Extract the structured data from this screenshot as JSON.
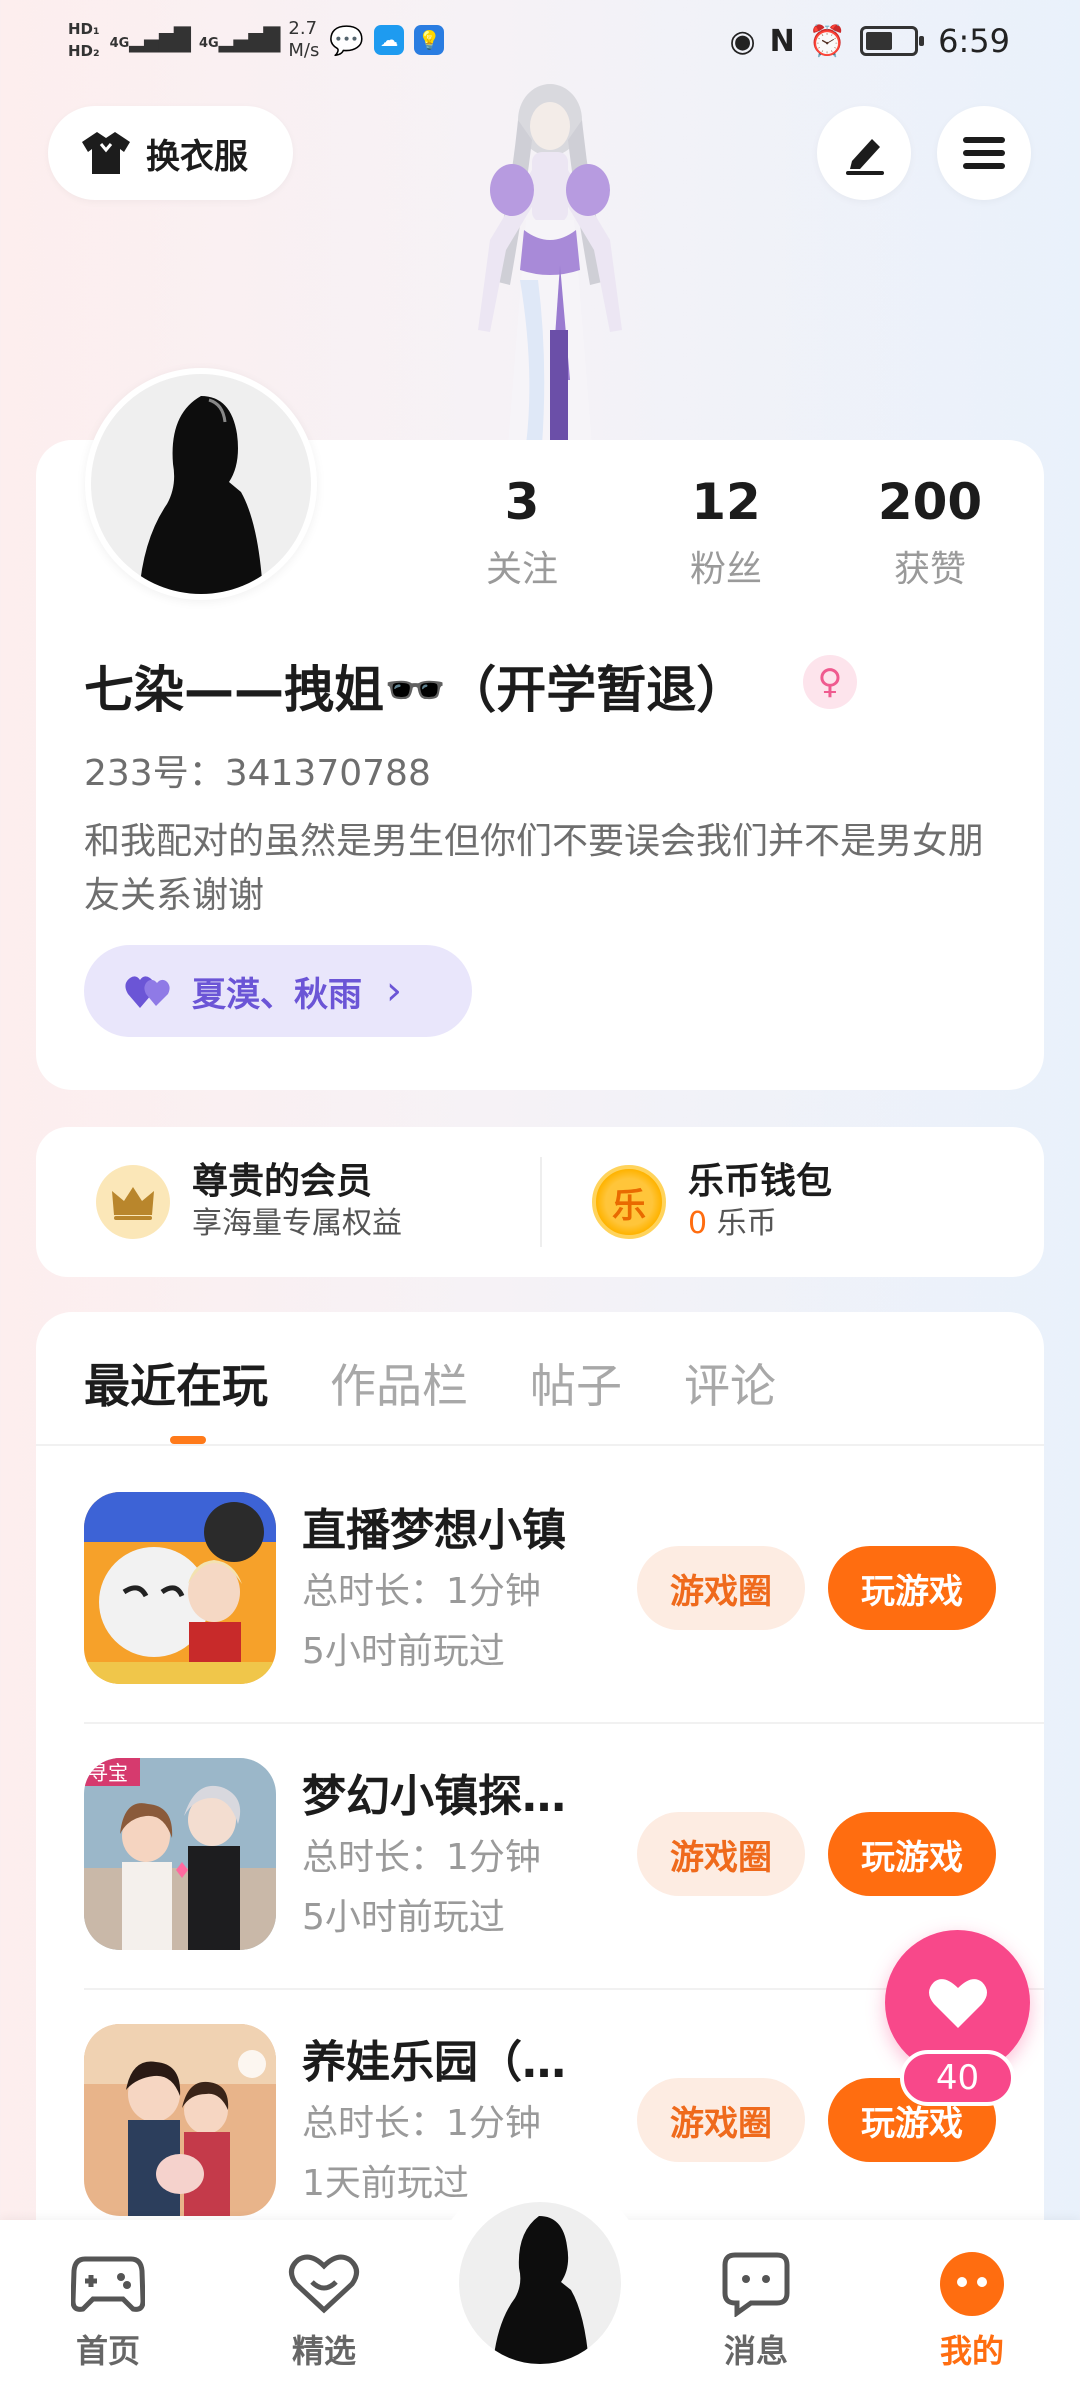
{
  "status_bar": {
    "hd1": "HD₁",
    "hd2": "HD₂",
    "signal1": "4G",
    "signal2": "4G",
    "speed_value": "2.7",
    "speed_unit": "M/s",
    "time": "6:59"
  },
  "header": {
    "outfit_label": "换衣服"
  },
  "profile": {
    "stats": [
      {
        "value": "3",
        "label": "关注"
      },
      {
        "value": "12",
        "label": "粉丝"
      },
      {
        "value": "200",
        "label": "获赞"
      }
    ],
    "nickname": "七染——拽姐🕶️（开学暂退）",
    "gender_symbol": "♀",
    "uid": "233号：341370788",
    "bio": "和我配对的虽然是男生但你们不要误会我们并不是男女朋友关系谢谢",
    "cp_names": "夏漠、秋雨",
    "cp_arrow": "›"
  },
  "vip": {
    "member_title": "尊贵的会员",
    "member_sub": "享海量专属权益",
    "wallet_title": "乐币钱包",
    "wallet_balance": "0",
    "wallet_unit": "乐币",
    "wallet_coin_char": "乐"
  },
  "tabs": [
    "最近在玩",
    "作品栏",
    "帖子",
    "评论"
  ],
  "games": [
    {
      "name": "直播梦想小镇",
      "duration": "总时长：1分钟",
      "last_played": "5小时前玩过",
      "circle_label": "游戏圈",
      "play_label": "玩游戏"
    },
    {
      "name": "梦幻小镇探…",
      "duration": "总时长：1分钟",
      "last_played": "5小时前玩过",
      "circle_label": "游戏圈",
      "play_label": "玩游戏"
    },
    {
      "name": "养娃乐园（…",
      "duration": "总时长：1分钟",
      "last_played": "1天前玩过",
      "circle_label": "游戏圈",
      "play_label": "玩游戏"
    }
  ],
  "game_icon_badge": "寻宝",
  "fab": {
    "count": "40"
  },
  "bottom_nav": [
    {
      "label": "首页",
      "icon": "gamepad-icon"
    },
    {
      "label": "精选",
      "icon": "heart-icon"
    },
    {
      "label": "消息",
      "icon": "chat-icon"
    },
    {
      "label": "我的",
      "icon": "smile-icon"
    }
  ],
  "colors": {
    "accent": "#ff6d10",
    "pink": "#f8488a",
    "purple": "#6b55d6"
  }
}
